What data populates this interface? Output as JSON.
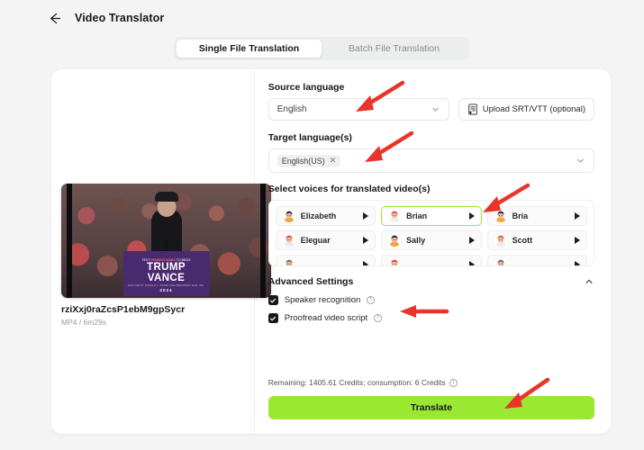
{
  "header": {
    "title": "Video Translator",
    "back_icon": "arrow-left-icon"
  },
  "tabs": [
    {
      "label": "Single File Translation",
      "active": true
    },
    {
      "label": "Batch File Translation",
      "active": false
    }
  ],
  "left_pane": {
    "file_name": "rziXxj0raZcsP1ebM9gpSycr",
    "file_meta": "MP4 / 6m29s",
    "video_preview": {
      "podium_top_prefix": "TEXT ",
      "podium_top_highlight": "PENNSYLVANIA",
      "podium_top_suffix": " TO 88022",
      "podium_line1": "TRUMP",
      "podium_line2": "VANCE",
      "podium_sub": "PAID FOR BY DONALD J. TRUMP FOR PRESIDENT 2024, INC.",
      "podium_year": "2024"
    }
  },
  "source_language": {
    "label": "Source language",
    "value": "English",
    "caret_icon": "chevron-down-icon",
    "upload_button": {
      "label": "Upload SRT/VTT (optional)",
      "icon": "file-upload-icon"
    }
  },
  "target_language": {
    "label": "Target language(s)",
    "chips": [
      {
        "label": "English(US)",
        "remove_icon": "close-icon"
      }
    ],
    "caret_icon": "chevron-down-icon"
  },
  "voices": {
    "label": "Select voices for translated video(s)",
    "items": [
      {
        "name": "Elizabeth",
        "selected": false,
        "avatar": "avatar-elizabeth",
        "hair": "#2a2a33",
        "skin": "#f0bb9a",
        "body": "#f6a33b",
        "play_icon": "play-icon"
      },
      {
        "name": "Brian",
        "selected": true,
        "avatar": "avatar-brian",
        "hair": "#e05a3a",
        "skin": "#f2c3a4",
        "body": "#eceef0",
        "play_icon": "play-icon"
      },
      {
        "name": "Bria",
        "selected": false,
        "avatar": "avatar-bria",
        "hair": "#2a2a33",
        "skin": "#f0bb9a",
        "body": "#f6a33b",
        "play_icon": "play-icon"
      },
      {
        "name": "Eleguar",
        "selected": false,
        "avatar": "avatar-eleguar",
        "hair": "#d94f2f",
        "skin": "#f2c3a4",
        "body": "#e9ebee",
        "play_icon": "play-icon"
      },
      {
        "name": "Sally",
        "selected": false,
        "avatar": "avatar-sally",
        "hair": "#23232b",
        "skin": "#f0bb9a",
        "body": "#f6a33b",
        "play_icon": "play-icon"
      },
      {
        "name": "Scott",
        "selected": false,
        "avatar": "avatar-scott",
        "hair": "#e05a3a",
        "skin": "#f2c3a4",
        "body": "#e9ebee",
        "play_icon": "play-icon"
      },
      {
        "name": "",
        "selected": false,
        "avatar": "avatar-row3-a",
        "hair": "#6b6b75",
        "skin": "#f0bb9a",
        "body": "#e9ebee",
        "play_icon": "play-icon"
      },
      {
        "name": "",
        "selected": false,
        "avatar": "avatar-row3-b",
        "hair": "#e0442a",
        "skin": "#f2c3a4",
        "body": "#e9ebee",
        "play_icon": "play-icon"
      },
      {
        "name": "",
        "selected": false,
        "avatar": "avatar-row3-c",
        "hair": "#6b6b75",
        "skin": "#f0bb9a",
        "body": "#e9ebee",
        "play_icon": "play-icon"
      }
    ]
  },
  "advanced_settings": {
    "title": "Advanced Settings",
    "collapse_icon": "chevron-up-icon",
    "options": [
      {
        "label": "Speaker recognition",
        "checked": true,
        "info_icon": "info-icon",
        "info_glyph": "!"
      },
      {
        "label": "Proofread video script",
        "checked": true,
        "info_icon": "info-icon",
        "info_glyph": "!"
      }
    ]
  },
  "footer": {
    "credits_text": "Remaining: 1405.61 Credits; consumption: 6 Credits",
    "credits_info_icon": "info-icon",
    "credits_info_glyph": "i",
    "translate_label": "Translate"
  },
  "colors": {
    "accent_green": "#9ae832",
    "annotation_red": "#e8342a",
    "page_bg": "#f4f4f5"
  },
  "annotations": [
    {
      "name": "arrow-to-source-language"
    },
    {
      "name": "arrow-to-target-language"
    },
    {
      "name": "arrow-to-brian-voice"
    },
    {
      "name": "arrow-to-proofread-option"
    },
    {
      "name": "arrow-to-translate-button"
    }
  ]
}
